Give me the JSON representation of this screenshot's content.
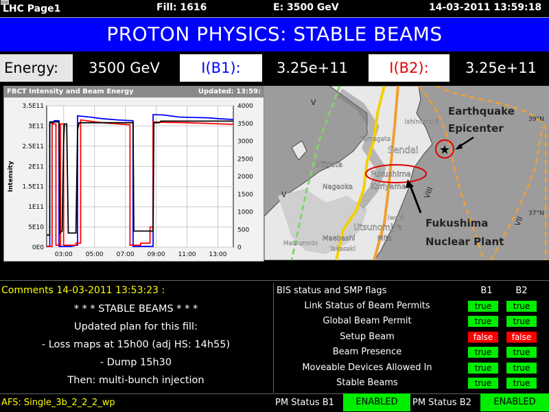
{
  "header": {
    "page": "LHC Page1",
    "fill": "Fill: 1616",
    "energy": "E:  3500 GeV",
    "datetime": "14-03-2011 13:59:18"
  },
  "title": "PROTON PHYSICS: STABLE BEAMS",
  "beam_row": {
    "energy_label": "Energy:",
    "energy_value": "3500 GeV",
    "ib1_label": "I(B1):",
    "ib1_value": "3.25e+11",
    "ib2_label": "I(B2):",
    "ib2_value": "3.25e+11"
  },
  "chart_panel": {
    "title": "FBCT Intensity and Beam Energy",
    "updated": "Updated: 13:59:"
  },
  "chart_data": {
    "type": "line",
    "ylabel": "Intensity",
    "y_ticks": [
      "0E0",
      "5E10",
      "1E11",
      "1.5E11",
      "2E11",
      "2.5E11",
      "3E11",
      "3.5E11"
    ],
    "y2_ticks": [
      "0",
      "500",
      "1000",
      "1500",
      "2000",
      "2500",
      "3000",
      "3500",
      "4000"
    ],
    "x_ticks": [
      "03:00",
      "05:00",
      "07:00",
      "09:00",
      "11:00",
      "13:00"
    ],
    "ylim": [
      0,
      350000000000.0
    ],
    "y2lim": [
      0,
      4000
    ],
    "xlim": [
      1.9,
      14.0
    ],
    "series": [
      {
        "color": "#0000ff",
        "points": [
          [
            1.9,
            0.02
          ],
          [
            2.1,
            0.02
          ],
          [
            2.1,
            3.1
          ],
          [
            2.35,
            3.1
          ],
          [
            2.4,
            3.13
          ],
          [
            2.7,
            3.13
          ],
          [
            2.7,
            0.02
          ],
          [
            3.5,
            0.02
          ],
          [
            3.8,
            0.05
          ],
          [
            3.9,
            0.05
          ],
          [
            3.9,
            3.25
          ],
          [
            4.7,
            3.22
          ],
          [
            5.5,
            3.18
          ],
          [
            6.5,
            3.15
          ],
          [
            7.5,
            3.13
          ],
          [
            7.5,
            0.02
          ],
          [
            8.8,
            0.02
          ],
          [
            8.8,
            3.28
          ],
          [
            9.5,
            3.27
          ],
          [
            10.5,
            3.22
          ],
          [
            11.5,
            3.21
          ],
          [
            12.5,
            3.2
          ],
          [
            13.0,
            3.18
          ],
          [
            14.0,
            3.16
          ]
        ]
      },
      {
        "color": "#ff0000",
        "points": [
          [
            1.9,
            0.02
          ],
          [
            2.25,
            0.02
          ],
          [
            2.25,
            3.05
          ],
          [
            2.5,
            3.05
          ],
          [
            2.5,
            0.05
          ],
          [
            2.8,
            0.05
          ],
          [
            2.8,
            3.05
          ],
          [
            3.0,
            3.05
          ],
          [
            3.0,
            0.05
          ],
          [
            3.8,
            0.05
          ],
          [
            3.8,
            0.1
          ],
          [
            4.1,
            0.1
          ],
          [
            4.1,
            3.15
          ],
          [
            4.7,
            3.12
          ],
          [
            5.5,
            3.08
          ],
          [
            6.5,
            3.05
          ],
          [
            7.3,
            3.03
          ],
          [
            7.3,
            0.05
          ],
          [
            8.0,
            0.05
          ],
          [
            8.0,
            0.1
          ],
          [
            8.6,
            0.1
          ],
          [
            8.6,
            0.5
          ],
          [
            8.8,
            0.5
          ],
          [
            8.8,
            3.1
          ],
          [
            9.3,
            3.09
          ],
          [
            11,
            3.08
          ],
          [
            12.5,
            3.06
          ],
          [
            14.0,
            3.04
          ]
        ]
      },
      {
        "color": "#000000",
        "points": [
          [
            1.9,
            0.3
          ],
          [
            2.1,
            0.3
          ],
          [
            2.1,
            3.08
          ],
          [
            2.3,
            3.08
          ],
          [
            2.4,
            3.1
          ],
          [
            2.7,
            3.1
          ],
          [
            2.75,
            0.35
          ],
          [
            2.9,
            0.4
          ],
          [
            3.0,
            2.6
          ],
          [
            3.05,
            3.05
          ],
          [
            3.2,
            3.05
          ],
          [
            3.3,
            0.35
          ],
          [
            3.8,
            0.35
          ],
          [
            3.9,
            2.9
          ],
          [
            4.0,
            3.08
          ],
          [
            7.5,
            3.08
          ],
          [
            7.55,
            0.4
          ],
          [
            8.8,
            0.4
          ],
          [
            8.85,
            3.08
          ],
          [
            9.2,
            3.08
          ],
          [
            9.3,
            3.12
          ],
          [
            14.0,
            3.12
          ]
        ]
      }
    ]
  },
  "map": {
    "earthquake_label_1": "Earthquake",
    "earthquake_label_2": "Epicenter",
    "plant_label_1": "Fukushima",
    "plant_label_2": "Nuclear Plant",
    "lat_39": "39°N",
    "lat_37": "37°N",
    "intensity_v": "V",
    "intensity_viii": "VIII",
    "intensity_vii": "VII",
    "intensity_v2": "V",
    "cities": [
      "Sendai",
      "Niigata",
      "Fukushima",
      "Nagaoka",
      "Koriyama",
      "Utsunomiya",
      "Maebashi",
      "Mito",
      "Takasaki",
      "Matsumoto",
      "Iwaki",
      "Ishinomaki",
      "Yamagata"
    ]
  },
  "comments": {
    "header": "Comments 14-03-2011 13:53:23 :",
    "lines": [
      "* * * STABLE BEAMS * * *",
      "Updated plan for this fill:",
      "- Loss maps at 15h00 (adj HS: 14h55)",
      "- Dump 15h30",
      "Then: multi-bunch injection"
    ]
  },
  "bis": {
    "header": "BIS status and SMP flags",
    "col_b1": "B1",
    "col_b2": "B2",
    "rows": [
      {
        "label": "Link Status of Beam Permits",
        "b1": "true",
        "b2": "true"
      },
      {
        "label": "Global Beam Permit",
        "b1": "true",
        "b2": "true"
      },
      {
        "label": "Setup Beam",
        "b1": "false",
        "b2": "false"
      },
      {
        "label": "Beam Presence",
        "b1": "true",
        "b2": "true"
      },
      {
        "label": "Moveable Devices Allowed In",
        "b1": "true",
        "b2": "true"
      },
      {
        "label": "Stable Beams",
        "b1": "true",
        "b2": "true"
      }
    ]
  },
  "status": {
    "afs": "AFS: Single_3b_2_2_2_wp",
    "pm_b1_label": "PM Status B1",
    "pm_b1_value": "ENABLED",
    "pm_b2_label": "PM Status B2",
    "pm_b2_value": "ENABLED"
  },
  "colors": {
    "title_bg": "#0000ff",
    "flag_true": "#00ee00",
    "flag_false": "#ff0000",
    "comment_header": "#ffff00"
  }
}
